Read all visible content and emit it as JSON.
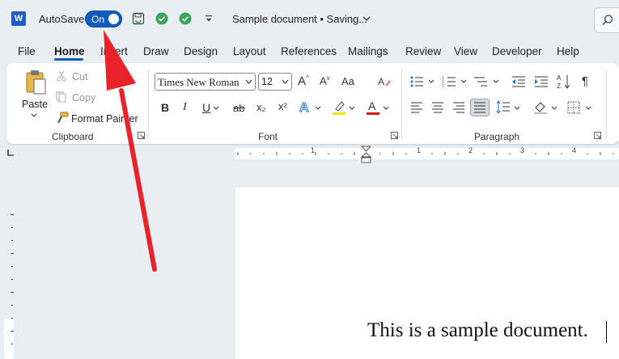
{
  "titlebar": {
    "app_logo": "W",
    "autosave_label": "AutoSave",
    "autosave_state": "On",
    "document_title": "Sample document • Saving...",
    "icons": [
      "save-icon",
      "sync-check-icon",
      "sync-check-icon",
      "customize-quick-access-icon",
      "search-icon"
    ]
  },
  "tabs": [
    "File",
    "Home",
    "Insert",
    "Draw",
    "Design",
    "Layout",
    "References",
    "Mailings",
    "Review",
    "View",
    "Developer",
    "Help"
  ],
  "active_tab": "Home",
  "clipboard": {
    "group_label": "Clipboard",
    "paste": "Paste",
    "cut": "Cut",
    "copy": "Copy",
    "format_painter": "Format Painter"
  },
  "font": {
    "group_label": "Font",
    "font_name": "Times New Roman",
    "font_size": "12",
    "bold": "B",
    "italic": "I",
    "underline": "U",
    "strikethrough": "ab",
    "subscript": "x₂",
    "superscript": "x²",
    "change_case": "Aa",
    "grow": "A",
    "shrink": "A",
    "highlight_color": "#f5e400",
    "font_color": "#d11c1c"
  },
  "paragraph": {
    "group_label": "Paragraph"
  },
  "ruler": {
    "numbers": [
      "1",
      "1",
      "2",
      "3",
      "4"
    ]
  },
  "document": {
    "text": "This is a sample document."
  },
  "colors": {
    "accent": "#0f5cbd",
    "arrow": "#e8232a"
  }
}
